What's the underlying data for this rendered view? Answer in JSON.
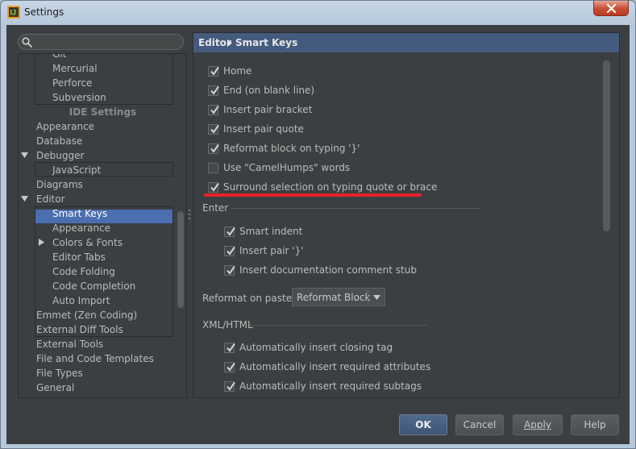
{
  "window": {
    "title": "Settings"
  },
  "search": {
    "value": "",
    "placeholder": ""
  },
  "tree": {
    "items": [
      {
        "label": "Git"
      },
      {
        "label": "Mercurial"
      },
      {
        "label": "Perforce"
      },
      {
        "label": "Subversion"
      },
      {
        "label": "IDE Settings"
      },
      {
        "label": "Appearance"
      },
      {
        "label": "Database"
      },
      {
        "label": "Debugger"
      },
      {
        "label": "JavaScript"
      },
      {
        "label": "Diagrams"
      },
      {
        "label": "Editor"
      },
      {
        "label": "Smart Keys"
      },
      {
        "label": "Appearance"
      },
      {
        "label": "Colors & Fonts"
      },
      {
        "label": "Editor Tabs"
      },
      {
        "label": "Code Folding"
      },
      {
        "label": "Code Completion"
      },
      {
        "label": "Auto Import"
      },
      {
        "label": "Emmet (Zen Coding)"
      },
      {
        "label": "External Diff Tools"
      },
      {
        "label": "External Tools"
      },
      {
        "label": "File and Code Templates"
      },
      {
        "label": "File Types"
      },
      {
        "label": "General"
      }
    ],
    "selected": "Smart Keys"
  },
  "breadcrumb": {
    "parent": "Editor",
    "current": "Smart Keys"
  },
  "options": [
    {
      "label": "Home",
      "checked": true
    },
    {
      "label": "End (on blank line)",
      "checked": true
    },
    {
      "label": "Insert pair bracket",
      "checked": true
    },
    {
      "label": "Insert pair quote",
      "checked": true
    },
    {
      "label": "Reformat block on typing '}'",
      "checked": true
    },
    {
      "label": "Use \"CamelHumps\" words",
      "checked": false
    },
    {
      "label": "Surround selection on typing quote or brace",
      "checked": true
    }
  ],
  "enter": {
    "title": "Enter",
    "options": [
      {
        "label": "Smart indent",
        "checked": true
      },
      {
        "label": "Insert pair '}'",
        "checked": true
      },
      {
        "label": "Insert documentation comment stub",
        "checked": true
      }
    ]
  },
  "reformat": {
    "label": "Reformat on paste:",
    "value": "Reformat Block"
  },
  "xml": {
    "title": "XML/HTML",
    "options": [
      {
        "label": "Automatically insert closing tag",
        "checked": true
      },
      {
        "label": "Automatically insert required attributes",
        "checked": true
      },
      {
        "label": "Automatically insert required subtags",
        "checked": true
      }
    ]
  },
  "buttons": {
    "ok": "OK",
    "cancel": "Cancel",
    "apply": "Apply",
    "help": "Help"
  },
  "colors": {
    "panel": "#3c3f41",
    "selection": "#4b6eaf",
    "header": "#455b7e",
    "highlight_underline": "#e8202a"
  }
}
